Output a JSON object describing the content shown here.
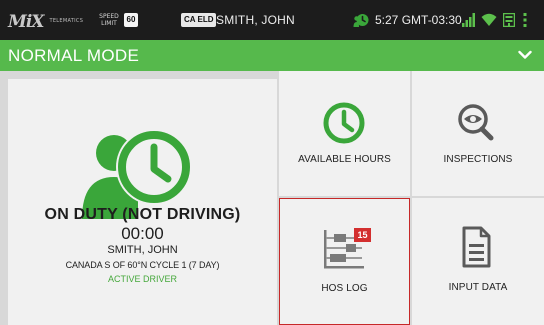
{
  "status_bar": {
    "brand_logo": "MiX",
    "brand_sub": "TELEMATICS",
    "speed_limit_label": "SPEED LIMIT",
    "speed_limit_value": "60",
    "eld_badge": "CA ELD",
    "driver_name": "SMITH, JOHN",
    "time": "5:27 GMT-03:30",
    "icons": [
      "clock-badge-icon",
      "signal-icon",
      "wifi-icon",
      "sim-icon",
      "overflow-menu-icon"
    ]
  },
  "mode_bar": {
    "title": "NORMAL MODE",
    "chevron_icon": "chevron-down-icon"
  },
  "status_panel": {
    "icon": "driver-clock-icon",
    "duty_status": "ON DUTY (NOT DRIVING)",
    "duty_time": "00:00",
    "driver_name": "SMITH, JOHN",
    "cycle": "CANADA S OF 60°N CYCLE 1 (7 DAY)",
    "driver_role": "ACTIVE DRIVER"
  },
  "tiles": {
    "available_hours": {
      "label": "AVAILABLE HOURS",
      "icon": "clock-icon"
    },
    "inspections": {
      "label": "INSPECTIONS",
      "icon": "magnifier-eye-icon"
    },
    "hos_log": {
      "label": "HOS LOG",
      "icon": "log-chart-icon",
      "badge": "15"
    },
    "input_data": {
      "label": "INPUT DATA",
      "icon": "document-icon"
    }
  },
  "colors": {
    "accent_green": "#56b94c",
    "icon_green": "#3aa63a",
    "status_bar": "#1c1c1c",
    "badge_red": "#d32f2f",
    "selected_border": "#c62828"
  }
}
